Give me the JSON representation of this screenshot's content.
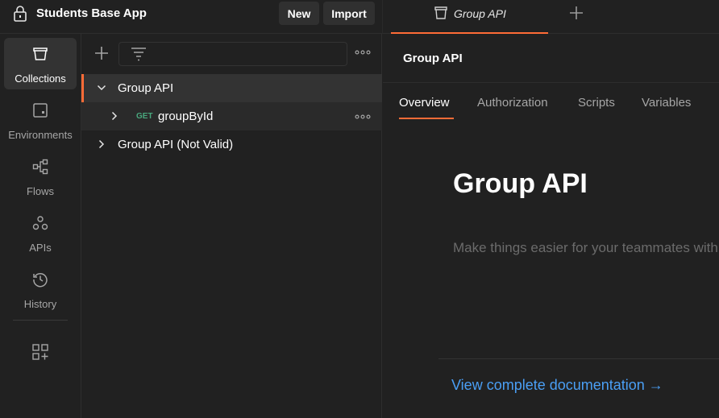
{
  "workspace": {
    "title": "Students Base App",
    "lock_icon": "lock-icon"
  },
  "toolbar": {
    "new_label": "New",
    "import_label": "Import"
  },
  "request_tab": {
    "label": "Group API",
    "icon": "collection-icon"
  },
  "sidebar": {
    "items": [
      {
        "label": "Collections",
        "icon": "collections-icon",
        "active": true
      },
      {
        "label": "Environments",
        "icon": "environments-icon"
      },
      {
        "label": "Flows",
        "icon": "flows-icon"
      },
      {
        "label": "APIs",
        "icon": "apis-icon"
      },
      {
        "label": "History",
        "icon": "history-icon"
      }
    ],
    "extra_icon": "add-widget-icon"
  },
  "tree": {
    "items": [
      {
        "label": "Group API",
        "expanded": true,
        "selected": true
      },
      {
        "method": "GET",
        "label": "groupById"
      },
      {
        "label": "Group API (Not Valid)",
        "expanded": false
      }
    ]
  },
  "main": {
    "title": "Group API",
    "tabs": [
      "Overview",
      "Authorization",
      "Scripts",
      "Variables"
    ],
    "active_tab": "Overview",
    "hero_title": "Group API",
    "description_placeholder": "Make things easier for your teammates with a complete collection description.",
    "doc_link": "View complete documentation →"
  },
  "colors": {
    "accent": "#ff6c37",
    "get_method": "#49a87e",
    "link": "#4a9ff5"
  }
}
